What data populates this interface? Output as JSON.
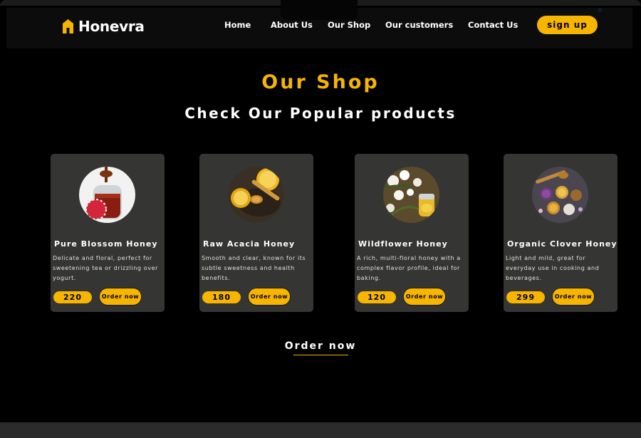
{
  "brand": {
    "name": "Honevra",
    "logo_icon": "house-icon",
    "accent": "#f7b500"
  },
  "nav": {
    "links": [
      "Home",
      "About Us",
      "Our Shop",
      "Our customers",
      "Contact Us"
    ],
    "signup_label": "sign up"
  },
  "section": {
    "title": "Our Shop",
    "subtitle": "Check Our Popular products"
  },
  "products": [
    {
      "name": "Pure Blossom Honey",
      "description": "Delicate and floral, perfect for sweetening tea or drizzling over yogurt.",
      "price": "220",
      "order_label": "Order now",
      "image": "honey-jar-image"
    },
    {
      "name": "Raw Acacia Honey",
      "description": " Smooth and clear, known for its subtle sweetness and health benefits.",
      "price": "180",
      "order_label": "Order now",
      "image": "lemon-honey-dipper-image"
    },
    {
      "name": "Wildflower Honey",
      "description": "A rich, multi-floral honey with a complex flavor profile, ideal for baking.",
      "price": "120",
      "order_label": "Order now",
      "image": "wildflower-honey-image"
    },
    {
      "name": "Organic Clover Honey",
      "description": "Light and mild, great for everyday use in cooking and beverages.",
      "price": "299",
      "order_label": "Order now",
      "image": "honey-bowls-image"
    }
  ],
  "footer_cta": {
    "label": "Order now"
  }
}
